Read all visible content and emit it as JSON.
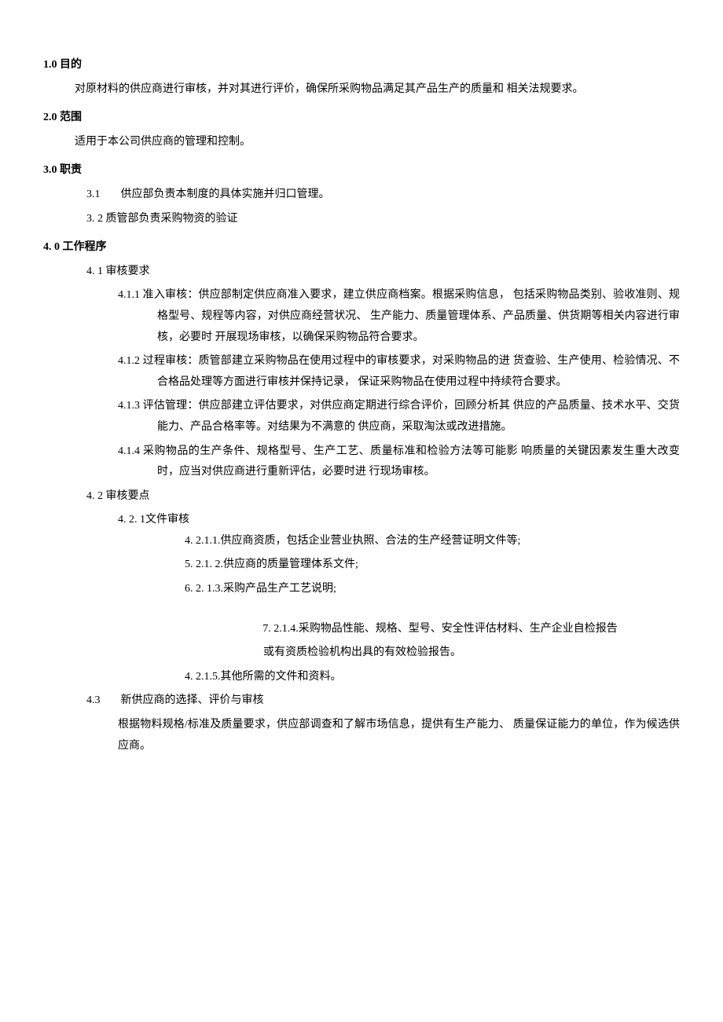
{
  "s1": {
    "h": "1.0 目的",
    "b": "对原材料的供应商进行审核，并对其进行评价，确保所采购物品满足其产品生产的质量和 相关法规要求。"
  },
  "s2": {
    "h": "2.0 范围",
    "b": "适用于本公司供应商的管理和控制。"
  },
  "s3": {
    "h": "3.0 职责",
    "i1": {
      "n": "3.1",
      "t": "供应部负责本制度的具体实施并归口管理。"
    },
    "i2": {
      "n": "3.",
      "t": "2 质管部负责采购物资的验证"
    }
  },
  "s4": {
    "h": "4. 0 工作程序",
    "s41": {
      "n": "4.",
      "t": "1  审核要求",
      "i1": "4.1.1  准入审核：供应部制定供应商准入要求，建立供应商档案。根据采购信息， 包括采购物品类别、验收准则、规格型号、规程等内容，对供应商经营状况、 生产能力、质量管理体系、产品质量、供货期等相关内容进行审核，必要时 开展现场审核，以确保采购物品符合要求。",
      "i2": "4.1.2  过程审核：质管部建立采购物品在使用过程中的审核要求，对采购物品的进 货查验、生产使用、检验情况、不合格品处理等方面进行审核并保持记录， 保证采购物品在使用过程中持续符合要求。",
      "i3": "4.1.3  评估管理：供应部建立评估要求，对供应商定期进行综合评价，回顾分析其 供应的产品质量、技术水平、交货能力、产品合格率等。对结果为不满意的 供应商，采取淘汰或改进措施。",
      "i4": "4.1.4  采购物品的生产条件、规格型号、生产工艺、质量标准和检验方法等可能影 响质量的关键因素发生重大改变时，应当对供应商进行重新评估，必要时进 行现场审核。"
    },
    "s42": {
      "n": "4.",
      "t": "2 审核要点",
      "h421": "4. 2. 1文件审核",
      "i1": "4. 2.1.1.供应商资质，包括企业营业执照、合法的生产经营证明文件等;",
      "i2": "5. 2.1. 2.供应商的质量管理体系文件;",
      "i3": "6. 2. 1.3.采购产品生产工艺说明;",
      "i4a": "7. 2.1.4.采购物品性能、规格、型号、安全性评估材料、生产企业自检报告",
      "i4b": "或有资质检验机构出具的有效检验报告。",
      "i5": "4. 2.1.5.其他所需的文件和资料。"
    },
    "s43": {
      "n": "4.3",
      "t": "新供应商的选择、评价与审核",
      "b": "根据物料规格/标准及质量要求，供应部调查和了解市场信息，提供有生产能力、 质量保证能力的单位，作为候选供应商。"
    }
  }
}
